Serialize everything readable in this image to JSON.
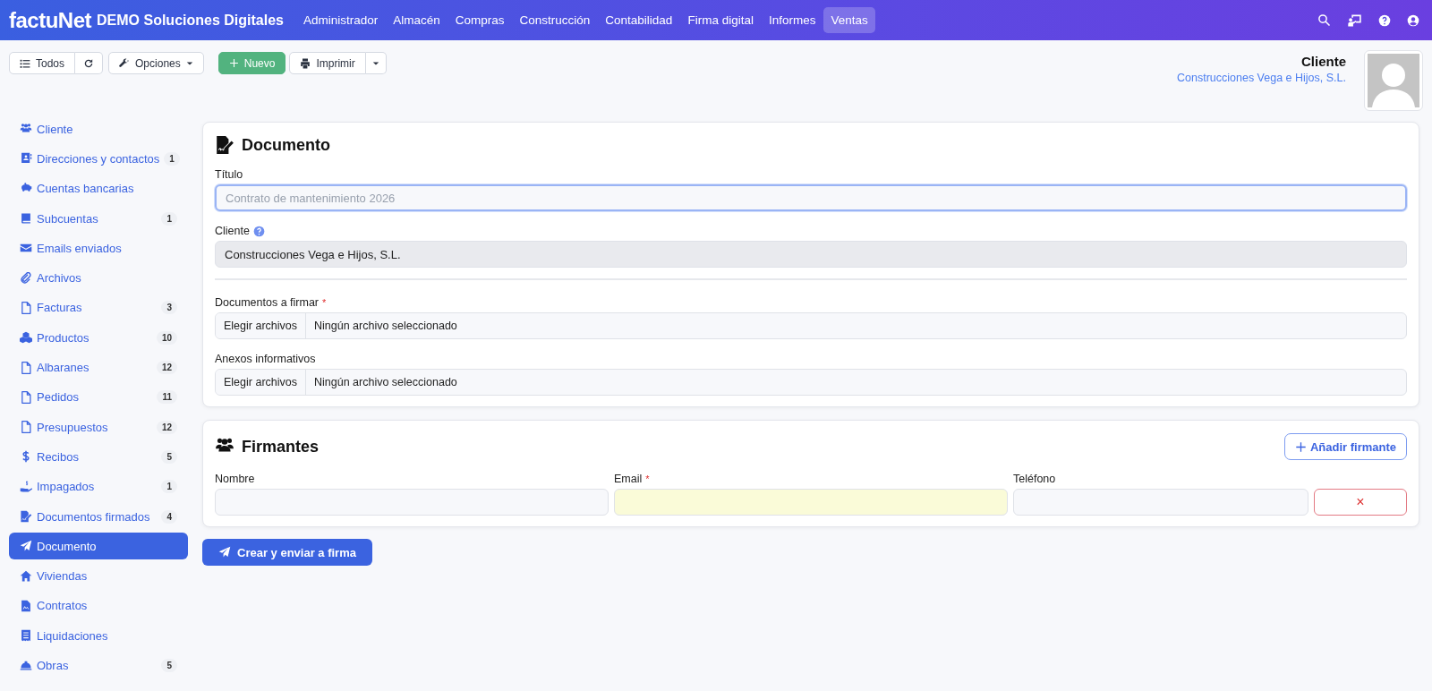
{
  "navbar": {
    "brand": "factuNet",
    "company": "DEMO Soluciones Digitales",
    "menu": [
      {
        "label": "Administrador",
        "selected": false
      },
      {
        "label": "Almacén",
        "selected": false
      },
      {
        "label": "Compras",
        "selected": false
      },
      {
        "label": "Construcción",
        "selected": false
      },
      {
        "label": "Contabilidad",
        "selected": false
      },
      {
        "label": "Firma digital",
        "selected": false
      },
      {
        "label": "Informes",
        "selected": false
      },
      {
        "label": "Ventas",
        "selected": true
      }
    ]
  },
  "toolbar": {
    "list_button": "Todos",
    "options_button": "Opciones",
    "new_button": "Nuevo",
    "print_button": "Imprimir"
  },
  "header": {
    "title": "Cliente",
    "subtitle": "Construcciones Vega e Hijos, S.L."
  },
  "sidebar": {
    "items": [
      {
        "label": "Cliente",
        "selected": false
      },
      {
        "label": "Direcciones y contactos",
        "count": "1",
        "selected": false
      },
      {
        "label": "Cuentas bancarias",
        "selected": false
      },
      {
        "label": "Subcuentas",
        "count": "1",
        "selected": false
      },
      {
        "label": "Emails enviados",
        "selected": false
      },
      {
        "label": "Archivos",
        "selected": false
      },
      {
        "label": "Facturas",
        "count": "3",
        "selected": false
      },
      {
        "label": "Productos",
        "count": "10",
        "selected": false
      },
      {
        "label": "Albaranes",
        "count": "12",
        "selected": false
      },
      {
        "label": "Pedidos",
        "count": "11",
        "selected": false
      },
      {
        "label": "Presupuestos",
        "count": "12",
        "selected": false
      },
      {
        "label": "Recibos",
        "count": "5",
        "selected": false
      },
      {
        "label": "Impagados",
        "count": "1",
        "selected": false
      },
      {
        "label": "Documentos firmados",
        "count": "4",
        "selected": false
      },
      {
        "label": "Documento",
        "selected": true
      },
      {
        "label": "Viviendas",
        "selected": false
      },
      {
        "label": "Contratos",
        "selected": false
      },
      {
        "label": "Liquidaciones",
        "selected": false
      },
      {
        "label": "Obras",
        "count": "5",
        "selected": false
      }
    ]
  },
  "document": {
    "title": "Documento",
    "title_field": {
      "label": "Título",
      "placeholder": "Contrato de mantenimiento 2026"
    },
    "client_field": {
      "label": "Cliente",
      "value": "Construcciones Vega e Hijos, S.L.",
      "disabled": true
    },
    "file_fields": [
      {
        "label": "Documentos a firmar",
        "required_mark": "*",
        "button": "Elegir archivos",
        "status": "Ningún archivo seleccionado"
      },
      {
        "label": "Anexos informativos",
        "button": "Elegir archivos",
        "status": "Ningún archivo seleccionado"
      }
    ]
  },
  "signers": {
    "title": "Firmantes",
    "add_button": "Añadir firmante",
    "columns": [
      {
        "label": "Nombre"
      },
      {
        "label": "Email",
        "required_mark": "*"
      },
      {
        "label": "Teléfono"
      }
    ],
    "rows": [
      {
        "fields": [
          {
            "highlighted": false
          },
          {
            "highlighted": true
          },
          {
            "highlighted": false
          }
        ],
        "remove_button": "×"
      }
    ]
  },
  "submit_button": "Crear y enviar a firma"
}
